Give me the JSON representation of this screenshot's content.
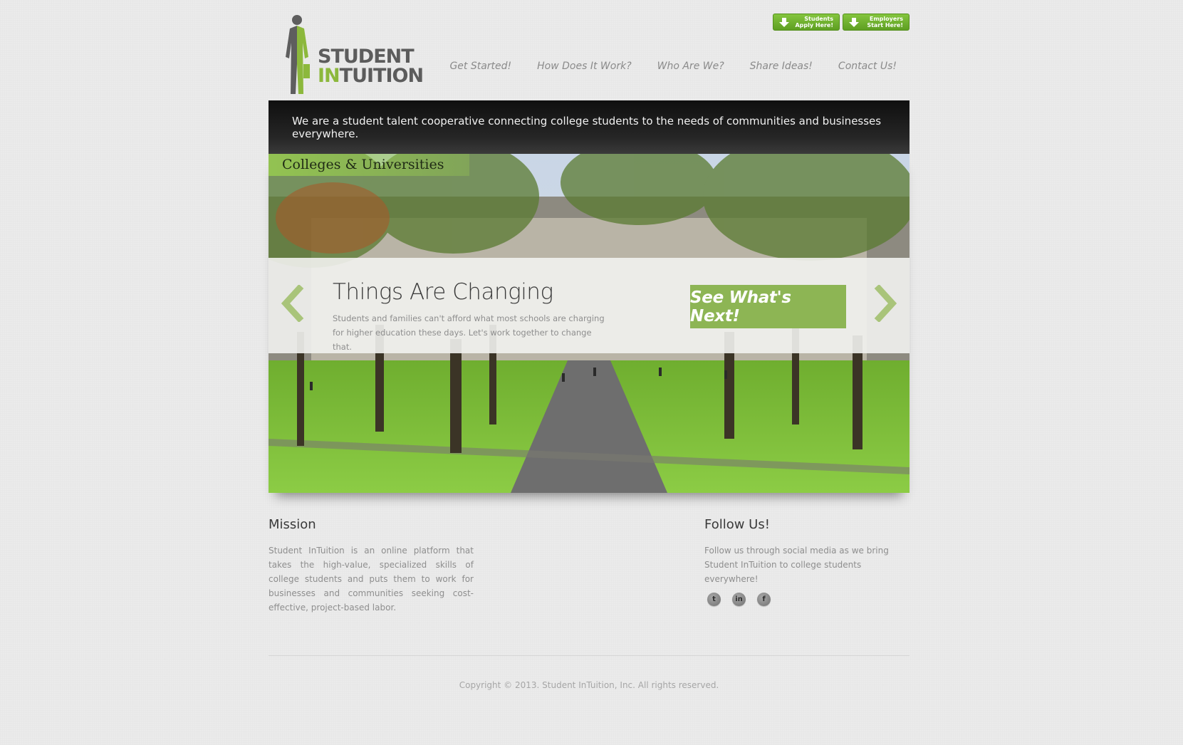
{
  "brand": {
    "line1": "STUDENT",
    "line2_highlight": "IN",
    "line2_rest": "TUITION"
  },
  "cta_buttons": [
    {
      "line1": "Students",
      "line2": "Apply Here!"
    },
    {
      "line1": "Employers",
      "line2": "Start Here!"
    }
  ],
  "nav": [
    "Get Started!",
    "How Does It Work?",
    "Who Are We?",
    "Share Ideas!",
    "Contact Us!"
  ],
  "tagline": "We are a student talent cooperative connecting college students to the needs of communities and businesses everywhere.",
  "hero": {
    "label": "Colleges & Universities",
    "title": "Things Are Changing",
    "description": "Students and families can't afford what most schools are charging for higher education these days. Let's work together to change that.",
    "button": "See What's Next!"
  },
  "mission": {
    "title": "Mission",
    "text": "Student InTuition is an online platform that takes the high-value, specialized skills of college students and puts them to work for businesses and communities seeking cost-effective, project-based labor."
  },
  "follow": {
    "title": "Follow Us!",
    "text": "Follow us through social media as we bring Student InTuition to college students everywhere!",
    "icons": [
      {
        "name": "twitter-icon",
        "glyph": "t"
      },
      {
        "name": "linkedin-icon",
        "glyph": "in"
      },
      {
        "name": "facebook-icon",
        "glyph": "f"
      }
    ]
  },
  "footer": {
    "copyright": "Copyright © 2013. Student InTuition, Inc. All rights reserved."
  },
  "colors": {
    "accent_green": "#8db554",
    "cta_green": "#6fb030",
    "tagline_bg": "#1a1a1a"
  }
}
